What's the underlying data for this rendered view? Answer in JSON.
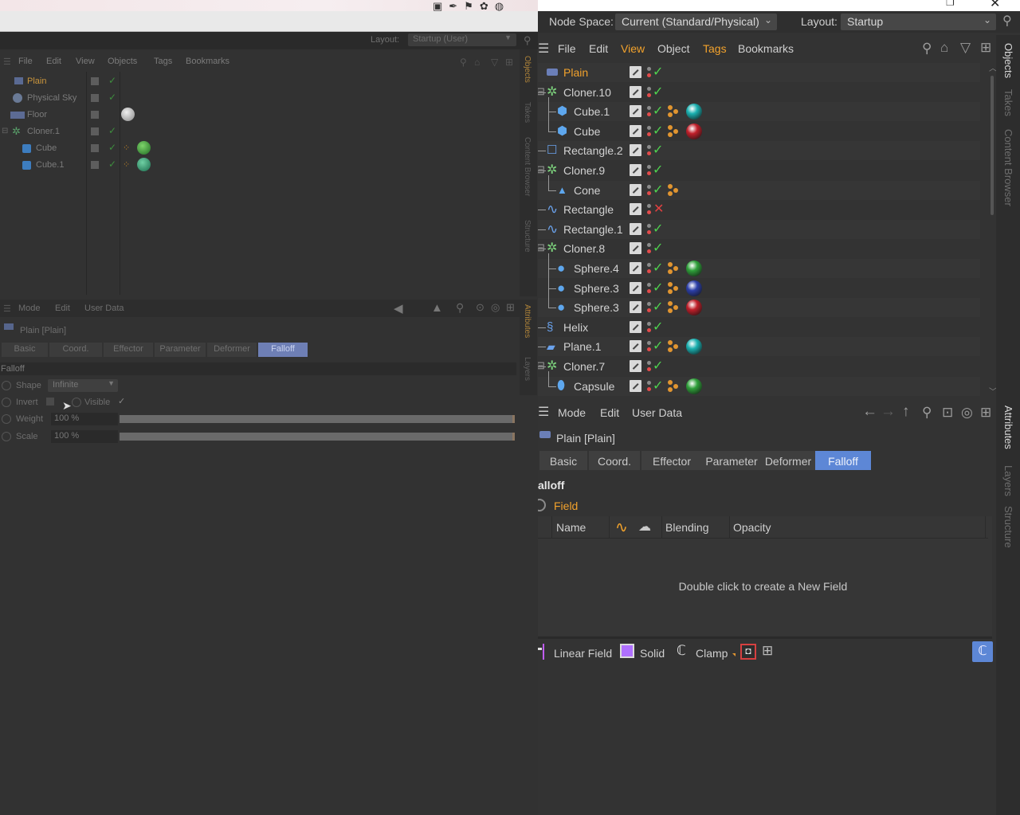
{
  "left_panel": {
    "layout_label": "Layout:",
    "layout_value": "Startup (User)",
    "menu": [
      "File",
      "Edit",
      "View",
      "Objects",
      "Tags",
      "Bookmarks"
    ],
    "objects": [
      {
        "name": "Plain",
        "highlight": true
      },
      {
        "name": "Physical Sky"
      },
      {
        "name": "Floor"
      },
      {
        "name": "Cloner.1"
      },
      {
        "name": "Cube"
      },
      {
        "name": "Cube.1"
      }
    ],
    "vtabs_top": [
      "Objects",
      "Takes",
      "Content Browser",
      "Structure"
    ],
    "attr_menu": [
      "Mode",
      "Edit",
      "User Data"
    ],
    "vtabs_bottom": [
      "Attributes",
      "Layers"
    ],
    "object_title": "Plain [Plain]",
    "tabs": [
      "Basic",
      "Coord.",
      "Effector",
      "Parameter",
      "Deformer",
      "Falloff"
    ],
    "active_tab": "Falloff",
    "section": "Falloff",
    "shape_label": "Shape",
    "shape_value": "Infinite",
    "invert_label": "Invert",
    "visible_label": "Visible",
    "weight_label": "Weight",
    "weight_value": "100 %",
    "scale_label": "Scale",
    "scale_value": "100 %"
  },
  "right_panel": {
    "node_space_label": "Node Space:",
    "node_space_value": "Current (Standard/Physical)",
    "layout_label": "Layout:",
    "layout_value": "Startup",
    "menu": [
      "File",
      "Edit",
      "View",
      "Object",
      "Tags",
      "Bookmarks"
    ],
    "menu_active": "View",
    "menu_highlight": "Tags",
    "objects": [
      {
        "name": "Plain",
        "icon": "plain-icon",
        "state": "check",
        "tags": false,
        "ball": "",
        "level": 0,
        "highlight": true
      },
      {
        "name": "Cloner.10",
        "icon": "cloner-icon",
        "state": "check",
        "tags": false,
        "ball": "",
        "level": 0
      },
      {
        "name": "Cube.1",
        "icon": "cube-icon",
        "state": "check",
        "tags": true,
        "ball": "#1ab0b0",
        "level": 1
      },
      {
        "name": "Cube",
        "icon": "cube-icon",
        "state": "check",
        "tags": true,
        "ball": "#c01f2a",
        "level": 1
      },
      {
        "name": "Rectangle.2",
        "icon": "rectangle-icon",
        "state": "check",
        "tags": false,
        "ball": "",
        "level": 0
      },
      {
        "name": "Cloner.9",
        "icon": "cloner-icon",
        "state": "check",
        "tags": false,
        "ball": "",
        "level": 0
      },
      {
        "name": "Cone",
        "icon": "cone-icon",
        "state": "check",
        "tags": true,
        "ball": "",
        "level": 1
      },
      {
        "name": "Rectangle",
        "icon": "spline-icon",
        "state": "cross",
        "tags": false,
        "ball": "",
        "level": 0
      },
      {
        "name": "Rectangle.1",
        "icon": "spline-icon",
        "state": "check",
        "tags": false,
        "ball": "",
        "level": 0
      },
      {
        "name": "Cloner.8",
        "icon": "cloner-icon",
        "state": "check",
        "tags": false,
        "ball": "",
        "level": 0
      },
      {
        "name": "Sphere.4",
        "icon": "sphere-icon",
        "state": "check",
        "tags": true,
        "ball": "#2fa03a",
        "level": 1
      },
      {
        "name": "Sphere.3",
        "icon": "sphere-icon",
        "state": "check",
        "tags": true,
        "ball": "#2c3fa8",
        "level": 1
      },
      {
        "name": "Sphere.3",
        "icon": "sphere-icon",
        "state": "check",
        "tags": true,
        "ball": "#c01f2a",
        "level": 1
      },
      {
        "name": "Helix",
        "icon": "helix-icon",
        "state": "check",
        "tags": false,
        "ball": "",
        "level": 0
      },
      {
        "name": "Plane.1",
        "icon": "plane-icon",
        "state": "check",
        "tags": true,
        "ball": "#1ab0b0",
        "level": 0
      },
      {
        "name": "Cloner.7",
        "icon": "cloner-icon",
        "state": "check",
        "tags": false,
        "ball": "",
        "level": 0
      },
      {
        "name": "Capsule",
        "icon": "capsule-icon",
        "state": "check",
        "tags": true,
        "ball": "#2fa03a",
        "level": 1
      }
    ],
    "vtabs_top": [
      "Objects",
      "Takes",
      "Content Browser"
    ],
    "vtabs_bottom": [
      "Attributes",
      "Layers",
      "Structure"
    ],
    "attr_menu": [
      "Mode",
      "Edit",
      "User Data"
    ],
    "object_title": "Plain [Plain]",
    "tabs": [
      "Basic",
      "Coord.",
      "Effector",
      "Parameter",
      "Deformer",
      "Falloff"
    ],
    "active_tab": "Falloff",
    "section": "alloff",
    "field_label": "Field",
    "columns": [
      "Name",
      "Blending",
      "Opacity"
    ],
    "empty_message": "Double click to create a New Field",
    "tools": [
      "Linear Field",
      "Solid",
      "Clamp"
    ],
    "colors": {
      "accent_tab": "#5d87d6",
      "check": "#4fd24f",
      "cross": "#e04040",
      "highlight_text": "#f2a22c"
    }
  }
}
